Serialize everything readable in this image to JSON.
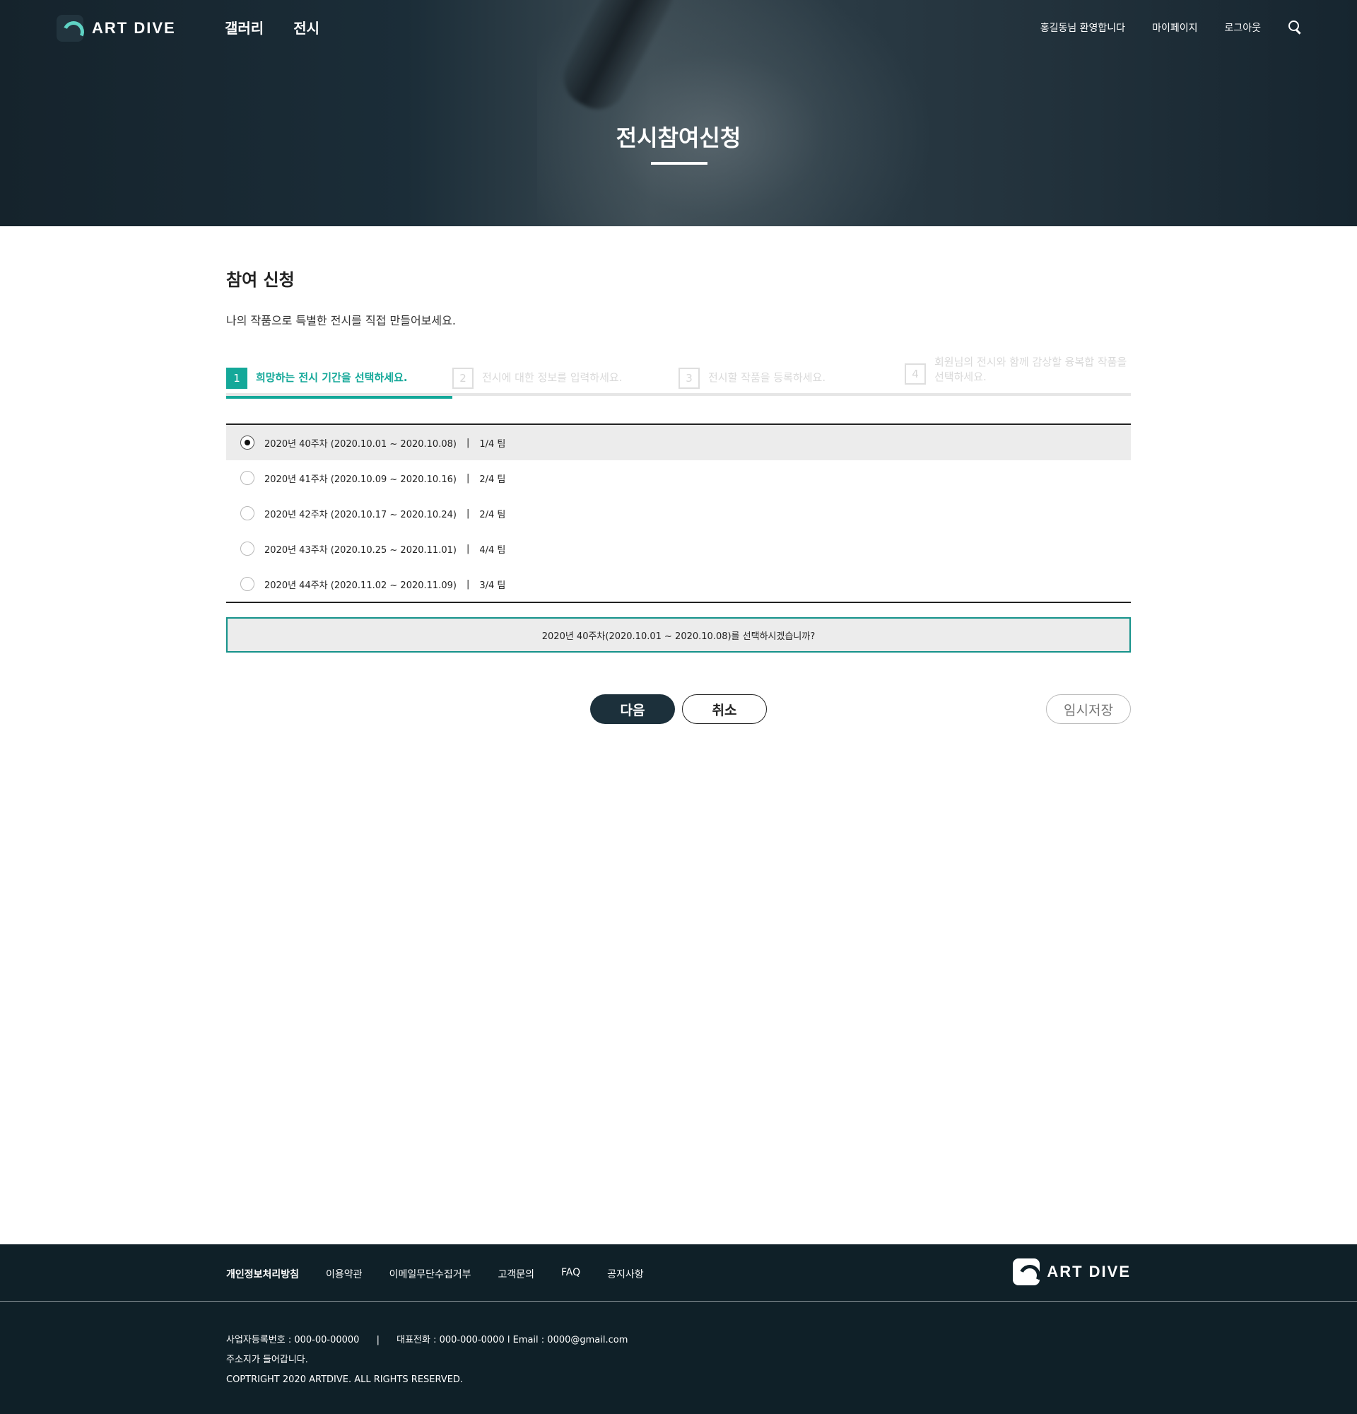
{
  "header": {
    "logo_text": "ART DIVE",
    "nav": [
      "갤러리",
      "전시"
    ],
    "welcome": "홍길동님 환영합니다",
    "mypage": "마이페이지",
    "logout": "로그아웃"
  },
  "hero": {
    "title": "전시참여신청"
  },
  "section": {
    "title": "참여 신청",
    "desc": "나의 작품으로 특별한 전시를 직접 만들어보세요."
  },
  "steps": [
    {
      "num": "1",
      "label": "희망하는 전시 기간을 선택하세요."
    },
    {
      "num": "2",
      "label": "전시에 대한 정보를 입력하세요."
    },
    {
      "num": "3",
      "label": "전시할 작품을 등록하세요."
    },
    {
      "num": "4",
      "label": "회원님의 전시와 함께 감상할 융복합 작품을",
      "label2": "선택하세요."
    }
  ],
  "options": [
    {
      "period": "2020년 40주차 (2020.10.01 ~ 2020.10.08)",
      "separator": "|",
      "teams": "1/4 팀",
      "selected": true
    },
    {
      "period": "2020년 41주차 (2020.10.09 ~ 2020.10.16)",
      "separator": "|",
      "teams": "2/4 팀",
      "selected": false
    },
    {
      "period": "2020년 42주차 (2020.10.17 ~ 2020.10.24)",
      "separator": "|",
      "teams": "2/4 팀",
      "selected": false
    },
    {
      "period": "2020년 43주차 (2020.10.25 ~ 2020.11.01)",
      "separator": "|",
      "teams": "4/4 팀",
      "selected": false
    },
    {
      "period": "2020년 44주차 (2020.11.02 ~ 2020.11.09)",
      "separator": "|",
      "teams": "3/4 팀",
      "selected": false
    }
  ],
  "confirm": "2020년 40주차(2020.10.01 ~ 2020.10.08)를 선택하시겠습니까?",
  "buttons": {
    "next": "다음",
    "cancel": "취소",
    "temp_save": "임시저장"
  },
  "footer": {
    "links": [
      "개인정보처리방침",
      "이용약관",
      "이메일무단수집거부",
      "고객문의",
      "FAQ",
      "공지사항"
    ],
    "logo_text": "ART DIVE",
    "biz_no": "사업자등록번호 : 000-00-00000",
    "separator": "|",
    "contact": "대표전화 : 000-000-0000 l Email : 0000@gmail.com",
    "address": "주소지가 들어갑니다.",
    "copyright": "COPTRIGHT 2020 ARTDIVE. ALL RIGHTS RESERVED."
  },
  "colors": {
    "accent": "#14a899",
    "dark": "#1c303b",
    "footer_bg": "#0f2028"
  }
}
